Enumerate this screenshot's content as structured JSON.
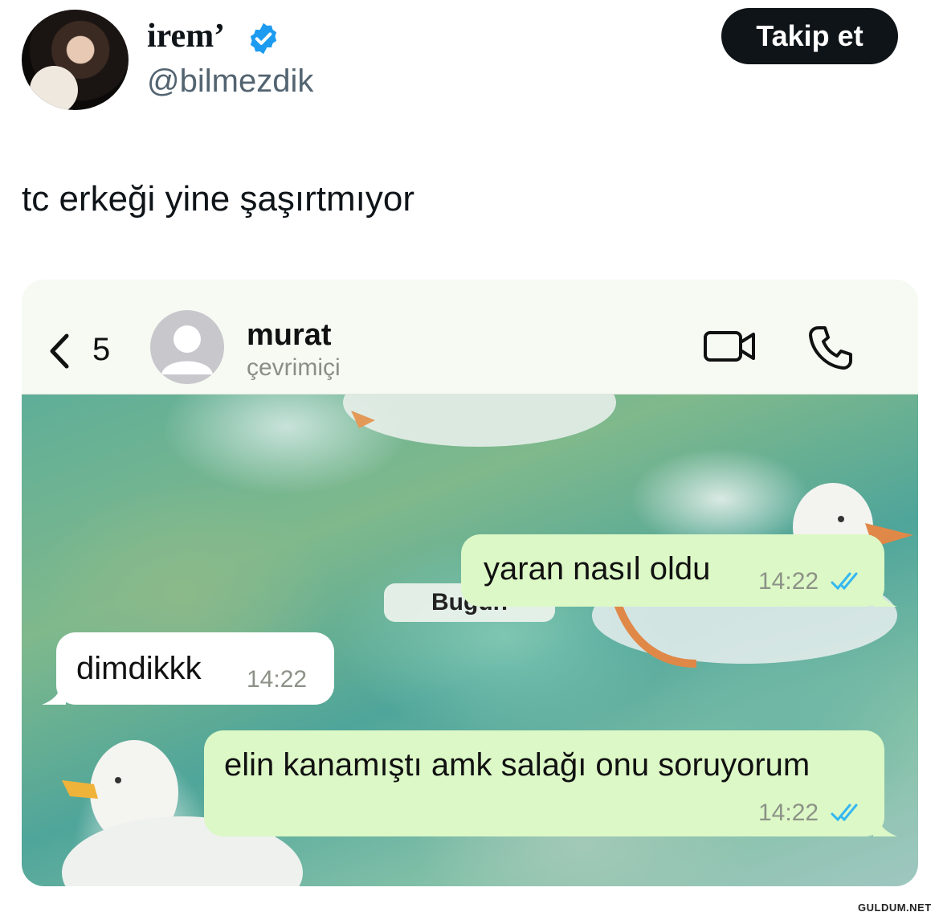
{
  "author": {
    "display_name": "irem’",
    "handle": "@bilmezdik",
    "verified": true,
    "follow_label": "Takip et"
  },
  "tweet": {
    "text": "tc erkeği yine şaşırtmıyor"
  },
  "chat": {
    "unread_count": "5",
    "contact_name": "murat",
    "contact_status": "çevrimiçi",
    "date_chip": "Bugün",
    "messages": [
      {
        "direction": "outgoing",
        "text": "yaran nasıl oldu",
        "time": "14:22",
        "read": true
      },
      {
        "direction": "incoming",
        "text": "dimdikkk",
        "time": "14:22"
      },
      {
        "direction": "outgoing",
        "text": "elin kanamıştı amk salağı onu soruyorum",
        "time": "14:22",
        "read": true
      }
    ]
  },
  "colors": {
    "follow_button": "#0f1419",
    "verified_badge": "#1d9bf0",
    "outgoing_bubble": "#dcf8c6",
    "incoming_bubble": "#ffffff",
    "read_ticks": "#34b7f1"
  },
  "watermark": "GULDUM.NET"
}
